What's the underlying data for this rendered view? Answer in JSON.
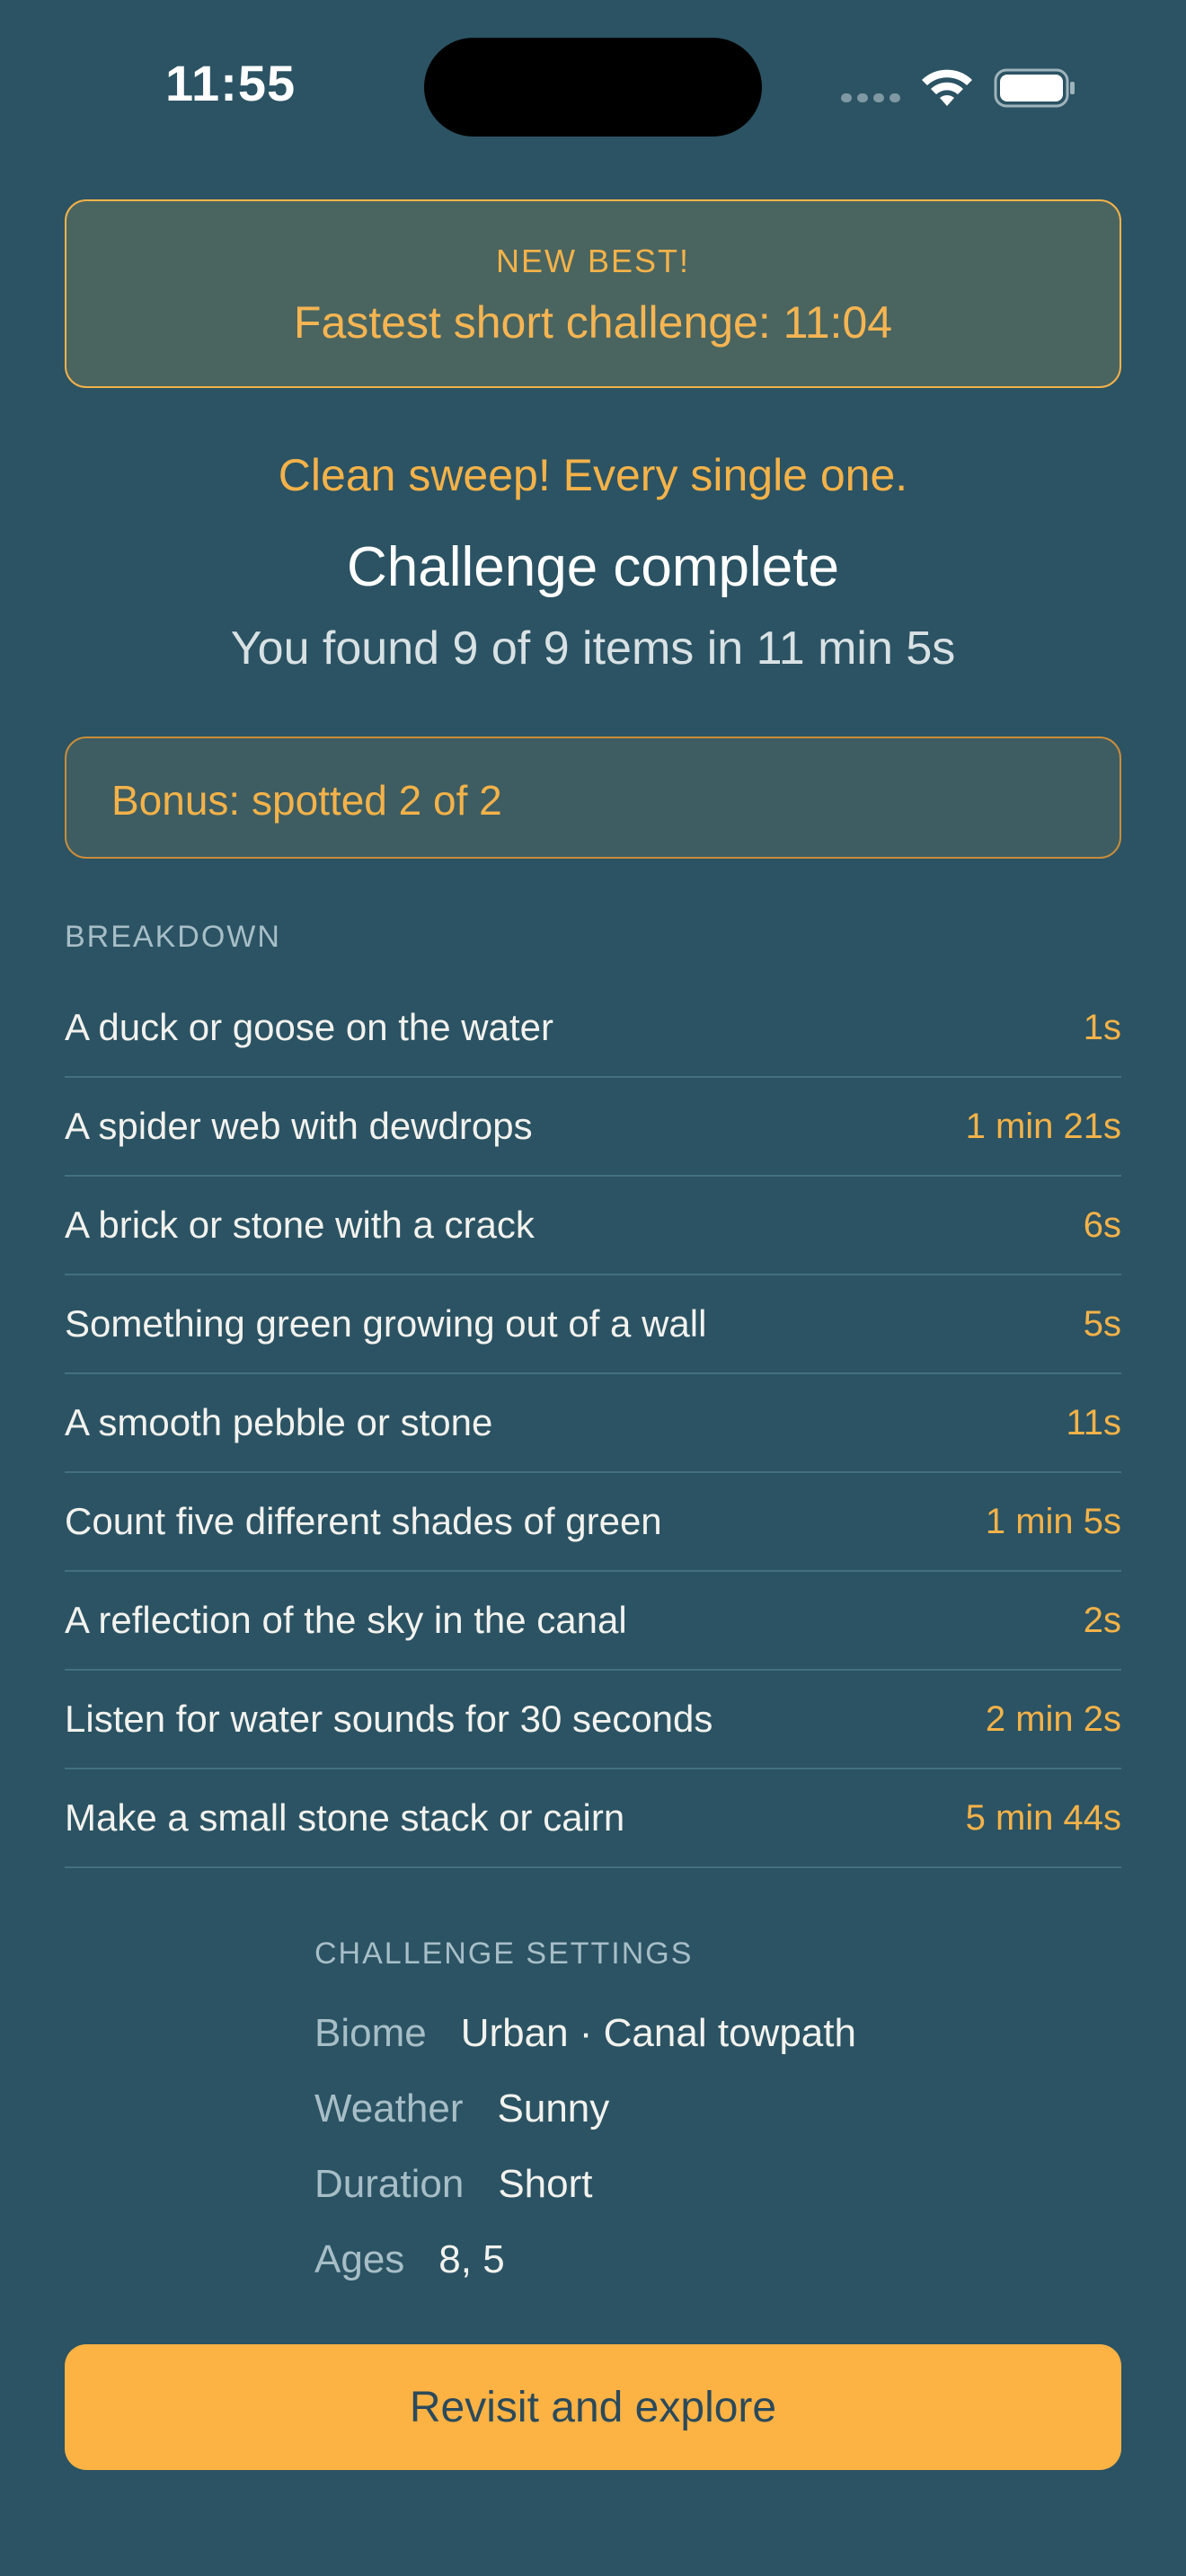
{
  "status_bar": {
    "time": "11:55"
  },
  "new_best": {
    "eyebrow": "NEW BEST!",
    "text": "Fastest short challenge: 11:04"
  },
  "summary": {
    "sweep_message": "Clean sweep! Every single one.",
    "title": "Challenge complete",
    "found_text": "You found 9 of 9 items in 11 min 5s"
  },
  "bonus": {
    "text": "Bonus: spotted 2 of 2"
  },
  "breakdown": {
    "label": "BREAKDOWN",
    "items": [
      {
        "name": "A duck or goose on the water",
        "time": "1s"
      },
      {
        "name": "A spider web with dewdrops",
        "time": "1 min 21s"
      },
      {
        "name": "A brick or stone with a crack",
        "time": "6s"
      },
      {
        "name": "Something green growing out of a wall",
        "time": "5s"
      },
      {
        "name": "A smooth pebble or stone",
        "time": "11s"
      },
      {
        "name": "Count five different shades of green",
        "time": "1 min 5s"
      },
      {
        "name": "A reflection of the sky in the canal",
        "time": "2s"
      },
      {
        "name": "Listen for water sounds for 30 seconds",
        "time": "2 min 2s"
      },
      {
        "name": "Make a small stone stack or cairn",
        "time": "5 min 44s"
      }
    ]
  },
  "settings": {
    "label": "CHALLENGE SETTINGS",
    "rows": [
      {
        "key": "Biome",
        "value": "Urban · Canal towpath"
      },
      {
        "key": "Weather",
        "value": "Sunny"
      },
      {
        "key": "Duration",
        "value": "Short"
      },
      {
        "key": "Ages",
        "value": "8, 5"
      }
    ]
  },
  "cta": {
    "label": "Revisit and explore"
  },
  "colors": {
    "background": "#2b5363",
    "accent": "#f4b249",
    "button": "#fdb244"
  }
}
